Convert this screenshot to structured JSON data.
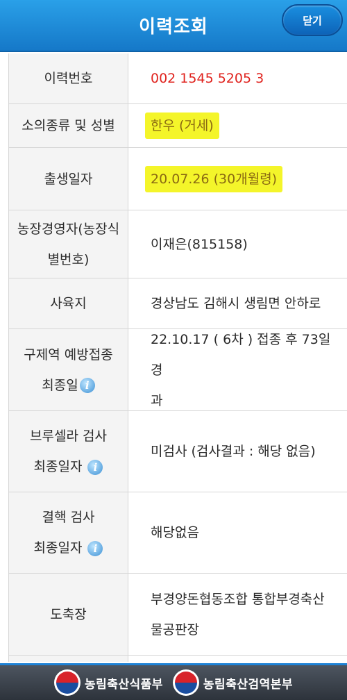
{
  "header": {
    "title": "이력조회",
    "close_label": "닫기"
  },
  "rows": [
    {
      "label": "이력번호",
      "value": "002 1545 5205 3"
    },
    {
      "label": "소의종류 및 성별",
      "value": "한우 (거세)"
    },
    {
      "label": "출생일자",
      "value": "20.07.26 (30개월령)"
    },
    {
      "label_line1": "농장경영자(농장식",
      "label_line2": "별번호)",
      "value": "이재은(815158)"
    },
    {
      "label": "사육지",
      "value": "경상남도 김해시 생림면 안하로"
    },
    {
      "label_line1": "구제역 예방접종",
      "label_line2": "최종일",
      "value_line1": "22.10.17 ( 6차 ) 접종 후 73일 경",
      "value_line2": "과"
    },
    {
      "label_line1": "브루셀라 검사",
      "label_line2": "최종일자",
      "value": "미검사 (검사결과 : 해당 없음)"
    },
    {
      "label_line1": "결핵 검사",
      "label_line2": "최종일자",
      "value": "해당없음"
    },
    {
      "label": "도축장",
      "value_line1": "부경양돈협동조합 통합부경축산",
      "value_line2": "물공판장"
    }
  ],
  "footer": {
    "org1": "농림축산식품부",
    "org2": "농림축산검역본부"
  },
  "icons": {
    "info": "info-icon",
    "emblem": "taegeuk-icon"
  },
  "colors": {
    "header_blue": "#1a8ee0",
    "trace_number_red": "#e0231e",
    "highlight_yellow": "#f4f52a",
    "highlight_text": "#8a6a12"
  }
}
